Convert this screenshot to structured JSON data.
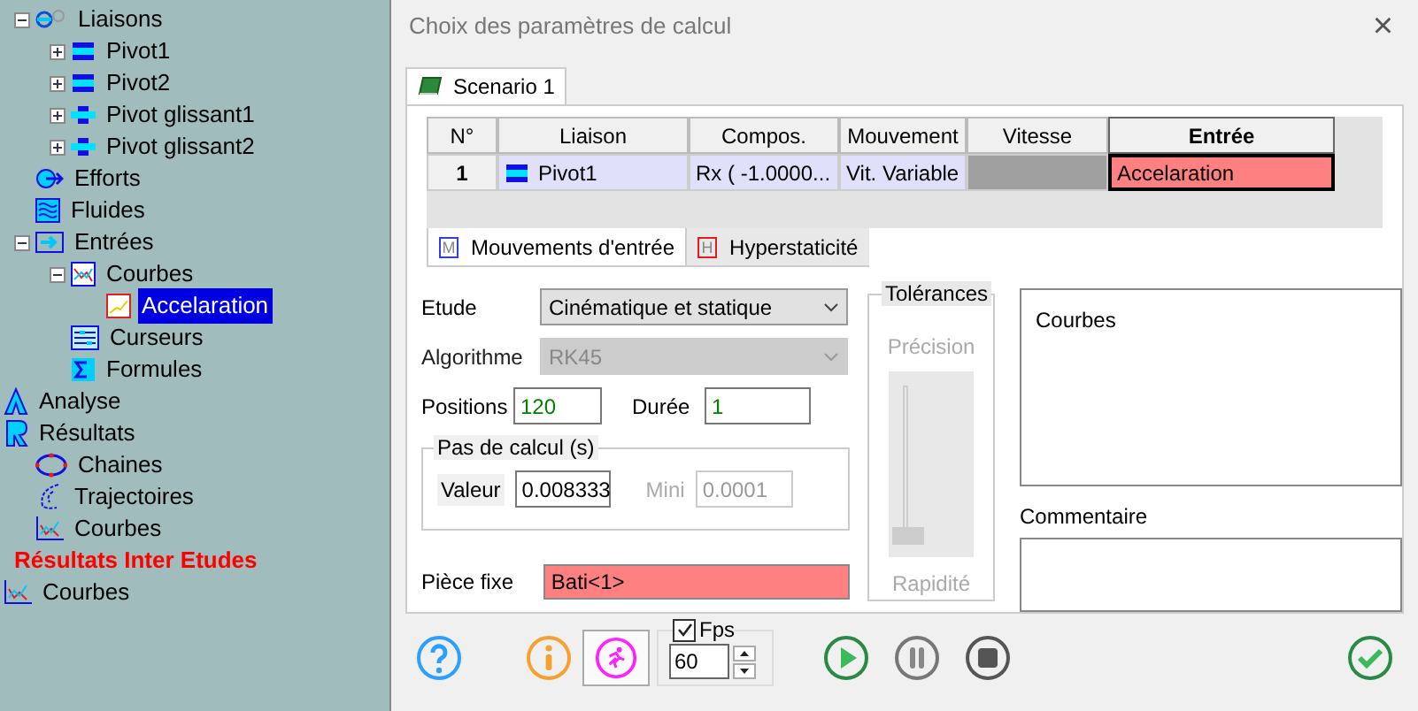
{
  "tree": [
    {
      "children": [
        {
          "label": "Liaisons",
          "kind": "link",
          "expanded": true,
          "selected": false,
          "children": [
            {
              "label": "Pivot1",
              "kind": "pivot",
              "expanded": false,
              "selected": false
            },
            {
              "label": "Pivot2",
              "kind": "pivot",
              "expanded": false,
              "selected": false
            },
            {
              "label": "Pivot glissant1",
              "kind": "slide",
              "expanded": false,
              "selected": false
            },
            {
              "label": "Pivot glissant2",
              "kind": "slide",
              "expanded": false,
              "selected": false
            }
          ]
        },
        {
          "label": "Efforts",
          "kind": "force",
          "selected": false
        },
        {
          "label": "Fluides",
          "kind": "fluid",
          "selected": false
        },
        {
          "label": "Entrées",
          "kind": "input",
          "expanded": true,
          "selected": false,
          "children": [
            {
              "label": "Courbes",
              "kind": "curves",
              "expanded": true,
              "selected": false,
              "children": [
                {
                  "label": "Accelaration",
                  "kind": "curve",
                  "selected": true
                }
              ]
            },
            {
              "label": "Curseurs",
              "kind": "sliders",
              "selected": false
            },
            {
              "label": "Formules",
              "kind": "formula",
              "selected": false
            }
          ]
        }
      ]
    },
    {
      "label": "Analyse",
      "kind": "analysis",
      "selected": false
    },
    {
      "label": "Résultats",
      "kind": "results",
      "selected": false,
      "children": [
        {
          "label": "Chaines",
          "kind": "chain",
          "selected": false
        },
        {
          "label": "Trajectoires",
          "kind": "trajectory",
          "selected": false
        },
        {
          "label": "Courbes",
          "kind": "plot",
          "selected": false
        }
      ]
    },
    {
      "label": "Résultats Inter Etudes",
      "kind": "heading",
      "selected": false
    },
    {
      "label": "Courbes",
      "kind": "plot",
      "selected": false
    }
  ],
  "dialog": {
    "title": "Choix des paramètres de calcul",
    "close": "×",
    "tabs": [
      {
        "label": "Scenario 1",
        "selected": true
      }
    ],
    "table": {
      "columns": [
        {
          "label": "N°",
          "selected": false
        },
        {
          "label": "Liaison",
          "selected": false
        },
        {
          "label": "Compos.",
          "selected": false
        },
        {
          "label": "Mouvement",
          "selected": false
        },
        {
          "label": "Vitesse",
          "selected": false
        },
        {
          "label": "Entrée",
          "selected": true
        }
      ],
      "rows": [
        {
          "cells": [
            {
              "kind": "number",
              "text": "1"
            },
            {
              "kind": "link",
              "text": "Pivot1"
            },
            {
              "kind": "text",
              "text": "Rx ( -1.0000..."
            },
            {
              "kind": "text",
              "text": "Vit. Variable"
            },
            {
              "kind": "blank"
            },
            {
              "kind": "alert",
              "text": "Accelaration"
            }
          ]
        }
      ]
    },
    "subtabs": [
      {
        "label": "Mouvements d'entrée",
        "icon": "M",
        "selected": true
      },
      {
        "label": "Hyperstaticité",
        "icon": "H",
        "selected": false
      }
    ],
    "etude": {
      "label": "Etude",
      "value": "Cinématique et statique",
      "disabled": false
    },
    "algorithme": {
      "label": "Algorithme",
      "value": "RK45",
      "disabled": true
    },
    "positions": {
      "label": "Positions",
      "value": "120"
    },
    "duree": {
      "label": "Durée",
      "value": "1"
    },
    "pas": {
      "title": "Pas de calcul (s)",
      "valeur_label": "Valeur",
      "valeur": "0.008333",
      "mini_label": "Mini",
      "mini": "0.0001",
      "mini_disabled": true
    },
    "piece_fixe": {
      "label": "Pièce fixe",
      "value": "Bati<1>"
    },
    "tolerances": {
      "title": "Tolérances",
      "top": "Précision",
      "bottom": "Rapidité",
      "level": 0
    },
    "courbes_list": {
      "header": "Courbes"
    },
    "commentaire": {
      "label": "Commentaire"
    },
    "fps": {
      "label": "Fps",
      "checked": true,
      "value": "60"
    },
    "run_mode": {
      "selected": true
    }
  }
}
